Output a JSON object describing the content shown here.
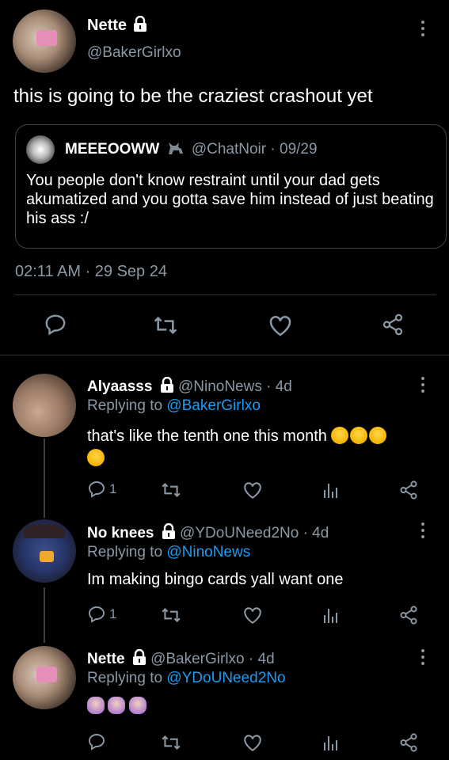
{
  "main_tweet": {
    "name": "Nette",
    "handle": "@BakerGirlxo",
    "text": "this is going to be the craziest crashout yet",
    "timestamp": "02:11 AM · 29 Sep 24"
  },
  "quote": {
    "name": "MEEEOOWW",
    "handle": "@ChatNoir",
    "date": "· 09/29",
    "text": "You people don't know restraint until your dad gets akumatized and you gotta save him instead of just beating his ass :/"
  },
  "replies": [
    {
      "name": "Alyaasss",
      "handle": "@NinoNews · 4d",
      "replying_prefix": "Replying to",
      "replying_to": "@BakerGirlxo",
      "text": "that's like the tenth one this month",
      "reply_count": "1"
    },
    {
      "name": "No knees",
      "handle": "@YDoUNeed2No · 4d",
      "replying_prefix": "Replying to",
      "replying_to": "@NinoNews",
      "text": "Im making bingo cards yall want one",
      "reply_count": "1"
    },
    {
      "name": "Nette",
      "handle": "@BakerGirlxo · 4d",
      "replying_prefix": "Replying to",
      "replying_to": "@YDoUNeed2No",
      "text": ""
    }
  ],
  "colors": {
    "link": "#1d9bf0",
    "muted": "#8b98a5",
    "background": "#000000"
  }
}
